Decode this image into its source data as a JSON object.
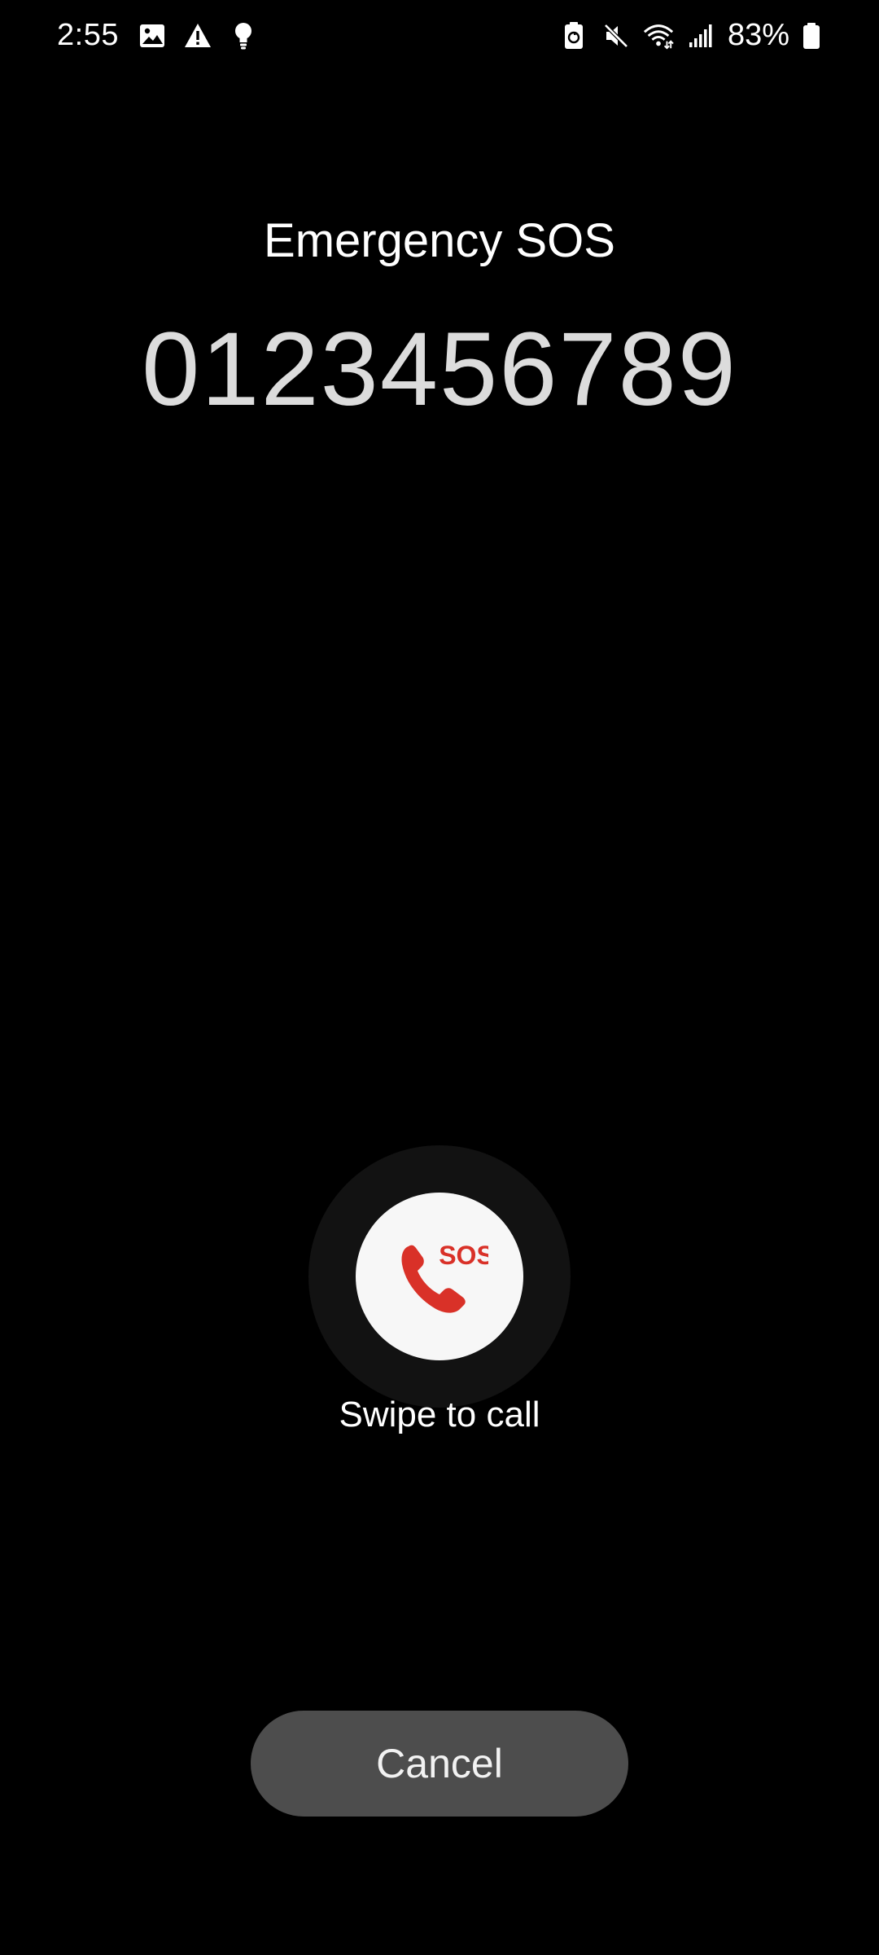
{
  "status_bar": {
    "time": "2:55",
    "battery_percent": "83%",
    "left_icons": [
      "image-icon",
      "warning-icon",
      "bulb-icon"
    ],
    "right_icons": [
      "battery-saver-icon",
      "mute-icon",
      "wifi-icon",
      "signal-icon",
      "battery-icon"
    ]
  },
  "screen": {
    "title": "Emergency SOS",
    "number": "0123456789"
  },
  "sos_control": {
    "badge": "SOS",
    "label": "Swipe to call",
    "accent_color": "#d93128"
  },
  "actions": {
    "cancel_label": "Cancel"
  }
}
